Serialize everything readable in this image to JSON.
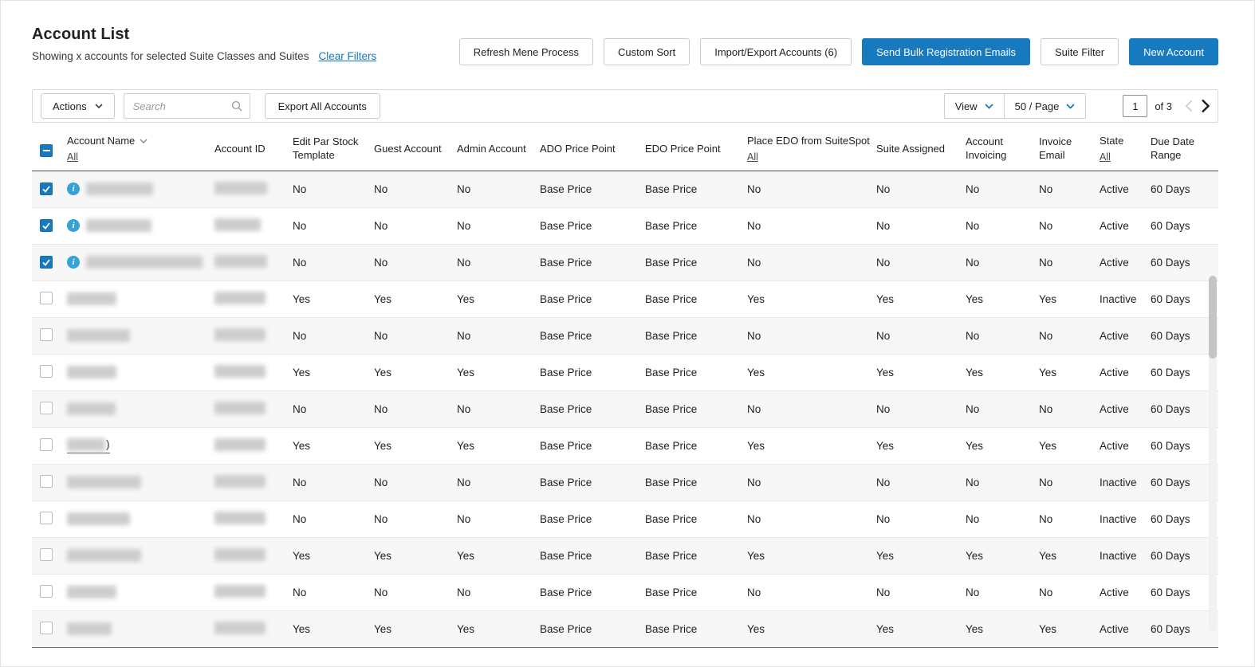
{
  "colors": {
    "primary_blue": "#1779be",
    "link_blue": "#1779be",
    "info_icon_blue": "#35a3da",
    "row_alt_background": "#f7f7f7",
    "border_gray": "#dadada",
    "text": "#222222"
  },
  "icons": {
    "chevron_down": "⌄",
    "chevron_left": "‹",
    "chevron_right": "›",
    "search": "⌕",
    "info": "i",
    "checkmark": "✓",
    "indeterminate_dash": "–"
  },
  "page": {
    "title": "Account List",
    "subtitle": "Showing x accounts for selected Suite Classes and Suites",
    "clear_filters_label": "Clear Filters"
  },
  "header_buttons": [
    {
      "label": "Refresh Mene Process",
      "variant": "secondary"
    },
    {
      "label": "Custom Sort",
      "variant": "secondary"
    },
    {
      "label": "Import/Export Accounts (6)",
      "variant": "secondary"
    },
    {
      "label": "Send Bulk Registration Emails",
      "variant": "primary"
    },
    {
      "label": "Suite Filter",
      "variant": "secondary"
    },
    {
      "label": "New Account",
      "variant": "primary"
    }
  ],
  "toolbar": {
    "actions_label": "Actions",
    "search_placeholder": "Search",
    "export_label": "Export All Accounts",
    "view_label": "View",
    "per_page_label": "50 / Page",
    "page_number": "1",
    "page_count_label": "of 3"
  },
  "table": {
    "header_checkbox_state": "indeterminate",
    "columns": [
      {
        "label": "Account Name",
        "sortable": true,
        "filter_all": "All"
      },
      {
        "label": "Account ID"
      },
      {
        "label": "Edit Par Stock Template"
      },
      {
        "label": "Guest Account"
      },
      {
        "label": "Admin Account"
      },
      {
        "label": "ADO Price Point"
      },
      {
        "label": "EDO Price Point"
      },
      {
        "label": "Place EDO from SuiteSpot",
        "filter_all": "All"
      },
      {
        "label": "Suite Assigned"
      },
      {
        "label": "Account Invoicing"
      },
      {
        "label": "Invoice Email"
      },
      {
        "label": "State",
        "filter_all": "All"
      },
      {
        "label": "Due Date Range"
      }
    ],
    "value_columns_note": "row.values align to columns index 2..12",
    "rows": [
      {
        "checked": true,
        "info": true,
        "name_redacted": true,
        "name_w": 84,
        "id_w": 66,
        "values": [
          "No",
          "No",
          "No",
          "Base Price",
          "Base Price",
          "No",
          "No",
          "No",
          "No",
          "Active",
          "60 Days"
        ]
      },
      {
        "checked": true,
        "info": true,
        "name_redacted": true,
        "name_w": 82,
        "id_w": 58,
        "values": [
          "No",
          "No",
          "No",
          "Base Price",
          "Base Price",
          "No",
          "No",
          "No",
          "No",
          "Active",
          "60 Days"
        ]
      },
      {
        "checked": true,
        "info": true,
        "name_redacted": true,
        "name_w": 146,
        "id_w": 66,
        "values": [
          "No",
          "No",
          "No",
          "Base Price",
          "Base Price",
          "No",
          "No",
          "No",
          "No",
          "Active",
          "60 Days"
        ]
      },
      {
        "checked": false,
        "info": false,
        "name_redacted": true,
        "name_w": 62,
        "id_w": 64,
        "values": [
          "Yes",
          "Yes",
          "Yes",
          "Base Price",
          "Base Price",
          "Yes",
          "Yes",
          "Yes",
          "Yes",
          "Inactive",
          "60 Days"
        ]
      },
      {
        "checked": false,
        "info": false,
        "name_redacted": true,
        "name_w": 79,
        "id_w": 64,
        "values": [
          "No",
          "No",
          "No",
          "Base Price",
          "Base Price",
          "No",
          "No",
          "No",
          "No",
          "Active",
          "60 Days"
        ]
      },
      {
        "checked": false,
        "info": false,
        "name_redacted": true,
        "name_w": 62,
        "id_w": 64,
        "values": [
          "Yes",
          "Yes",
          "Yes",
          "Base Price",
          "Base Price",
          "Yes",
          "Yes",
          "Yes",
          "Yes",
          "Active",
          "60 Days"
        ]
      },
      {
        "checked": false,
        "info": false,
        "name_redacted": true,
        "name_w": 61,
        "id_w": 64,
        "values": [
          "No",
          "No",
          "No",
          "Base Price",
          "Base Price",
          "No",
          "No",
          "No",
          "No",
          "Active",
          "60 Days"
        ]
      },
      {
        "checked": false,
        "info": false,
        "name_redacted": true,
        "name_w": 48,
        "id_w": 64,
        "link": true,
        "name_suffix": ")",
        "values": [
          "Yes",
          "Yes",
          "Yes",
          "Base Price",
          "Base Price",
          "Yes",
          "Yes",
          "Yes",
          "Yes",
          "Active",
          "60 Days"
        ]
      },
      {
        "checked": false,
        "info": false,
        "name_redacted": true,
        "name_w": 93,
        "id_w": 64,
        "values": [
          "No",
          "No",
          "No",
          "Base Price",
          "Base Price",
          "No",
          "No",
          "No",
          "No",
          "Inactive",
          "60 Days"
        ]
      },
      {
        "checked": false,
        "info": false,
        "name_redacted": true,
        "name_w": 79,
        "id_w": 64,
        "values": [
          "No",
          "No",
          "No",
          "Base Price",
          "Base Price",
          "No",
          "No",
          "No",
          "No",
          "Inactive",
          "60 Days"
        ]
      },
      {
        "checked": false,
        "info": false,
        "name_redacted": true,
        "name_w": 93,
        "id_w": 64,
        "values": [
          "Yes",
          "Yes",
          "Yes",
          "Base Price",
          "Base Price",
          "Yes",
          "Yes",
          "Yes",
          "Yes",
          "Inactive",
          "60 Days"
        ]
      },
      {
        "checked": false,
        "info": false,
        "name_redacted": true,
        "name_w": 62,
        "id_w": 64,
        "values": [
          "No",
          "No",
          "No",
          "Base Price",
          "Base Price",
          "No",
          "No",
          "No",
          "No",
          "Active",
          "60 Days"
        ]
      },
      {
        "checked": false,
        "info": false,
        "name_redacted": true,
        "name_w": 56,
        "id_w": 64,
        "values": [
          "Yes",
          "Yes",
          "Yes",
          "Base Price",
          "Base Price",
          "Yes",
          "Yes",
          "Yes",
          "Yes",
          "Active",
          "60 Days"
        ]
      }
    ]
  }
}
